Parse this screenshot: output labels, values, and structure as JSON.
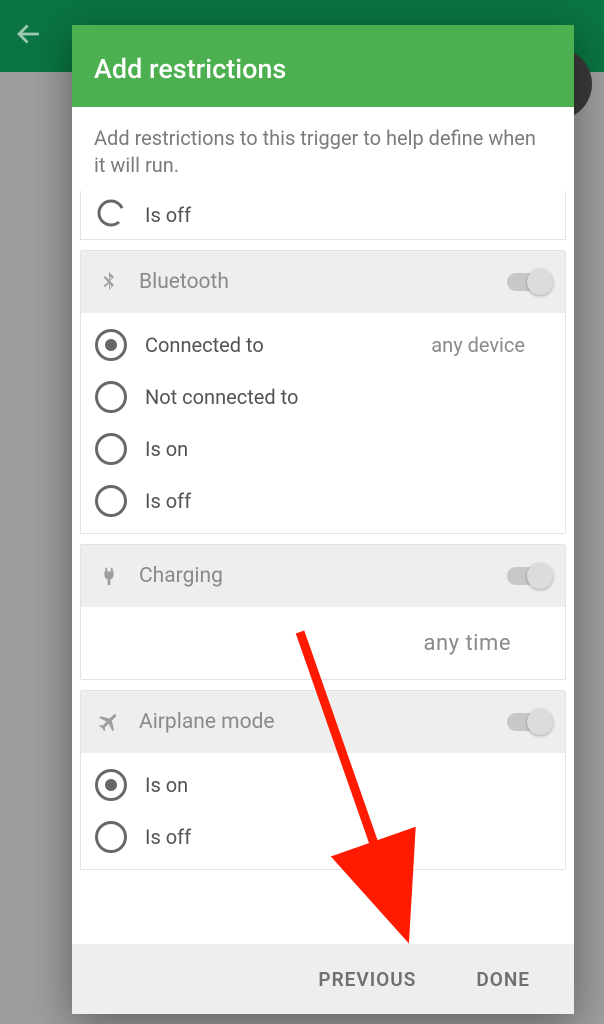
{
  "app_bar": {},
  "dialog": {
    "title": "Add restrictions",
    "subtitle": "Add restrictions to this trigger to help define when it will run."
  },
  "cutoff_option": {
    "label": "Is off"
  },
  "sections": {
    "bluetooth": {
      "title": "Bluetooth",
      "toggle": false,
      "extra_label": "any device",
      "options": [
        {
          "label": "Connected to",
          "selected": true
        },
        {
          "label": "Not connected to",
          "selected": false
        },
        {
          "label": "Is on",
          "selected": false
        },
        {
          "label": "Is off",
          "selected": false
        }
      ]
    },
    "charging": {
      "title": "Charging",
      "toggle": false,
      "any_label": "any time"
    },
    "airplane": {
      "title": "Airplane mode",
      "toggle": false,
      "options": [
        {
          "label": "Is on",
          "selected": true
        },
        {
          "label": "Is off",
          "selected": false
        }
      ]
    }
  },
  "footer": {
    "previous": "PREVIOUS",
    "done": "DONE"
  }
}
